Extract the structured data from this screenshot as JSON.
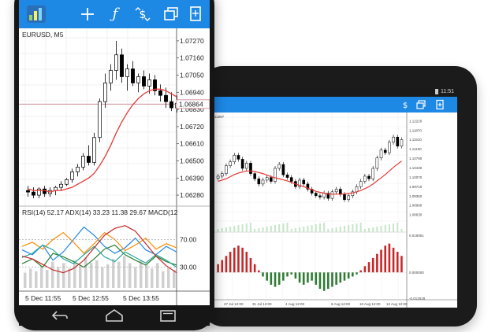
{
  "colors": {
    "toolbar_blue": "#1e88e5",
    "bull_candle": "#ffffff",
    "bear_candle": "#000000",
    "moving_average": "#e53935",
    "price_line": "#c97b8a",
    "osc_green": "#2e7d32",
    "osc_red": "#c62828"
  },
  "phone": {
    "toolbar_icons": [
      "app-logo-icon",
      "crosshair-icon",
      "function-icon",
      "trade-icon",
      "windows-icon",
      "new-document-icon"
    ],
    "chart_symbol": "EURUSD, M5",
    "price_axis": [
      "1.07270",
      "1.07160",
      "1.07050",
      "1.06940",
      "1.06864",
      "1.06830",
      "1.06720",
      "1.06610",
      "1.06500",
      "1.06390",
      "1.06280"
    ],
    "current_price": "1.06864",
    "indicator_header": "RSI(14) 52.17 ADX(14) 33.23 11.38 29.67 MACD(12",
    "indicator_axis": [
      "70.00",
      "30.00"
    ],
    "time_axis": [
      "5 Dec 11:55",
      "5 Dec 12:55",
      "5 Dec 13:55"
    ],
    "nav_icons": [
      "back-icon",
      "home-icon",
      "recent-apps-icon"
    ]
  },
  "tablet": {
    "status_time": "11:51",
    "chart_symbol": "11997",
    "price_axis": [
      "1.12220",
      "1.11870",
      "1.11510",
      "1.11150",
      "1.10790",
      "1.10430",
      "1.10070",
      "1.09710",
      "1.09350",
      "1.08990",
      "1.08630"
    ],
    "indicator_axis": [
      "0.018051",
      "0.000000",
      "-0.012528"
    ],
    "time_axis": [
      "27 Jul 12:00",
      "31 Jul 12:00",
      "4 Aug 12:00",
      "6 Aug 12:00",
      "10 Aug 12:00",
      "12 Aug 12:00"
    ],
    "side_icons": [
      "search-icon",
      "down-arrow-icon"
    ]
  },
  "chart_data": [
    {
      "type": "candlestick",
      "symbol": "EURUSD, M5",
      "ylim": [
        1.0623,
        1.0733
      ],
      "current_price": 1.06864,
      "x": [
        "5 Dec 11:55",
        "5 Dec 12:55",
        "5 Dec 13:55"
      ],
      "ohlc": [
        [
          1.0631,
          1.0634,
          1.0627,
          1.063
        ],
        [
          1.063,
          1.0633,
          1.0626,
          1.0628
        ],
        [
          1.0628,
          1.0633,
          1.0626,
          1.0632
        ],
        [
          1.0632,
          1.0634,
          1.0627,
          1.0629
        ],
        [
          1.0629,
          1.0633,
          1.0627,
          1.0631
        ],
        [
          1.0631,
          1.0634,
          1.0628,
          1.0633
        ],
        [
          1.0633,
          1.0637,
          1.0631,
          1.0635
        ],
        [
          1.0635,
          1.0639,
          1.0634,
          1.0638
        ],
        [
          1.0638,
          1.0645,
          1.0636,
          1.0643
        ],
        [
          1.0643,
          1.0648,
          1.064,
          1.0646
        ],
        [
          1.0646,
          1.0655,
          1.0644,
          1.0653
        ],
        [
          1.0653,
          1.066,
          1.0647,
          1.0649
        ],
        [
          1.0649,
          1.0668,
          1.0647,
          1.0665
        ],
        [
          1.0665,
          1.069,
          1.0662,
          1.0688
        ],
        [
          1.0688,
          1.0706,
          1.0684,
          1.07
        ],
        [
          1.07,
          1.0712,
          1.0695,
          1.0708
        ],
        [
          1.0708,
          1.0727,
          1.0702,
          1.0718
        ],
        [
          1.0718,
          1.0722,
          1.07,
          1.0704
        ],
        [
          1.0704,
          1.0712,
          1.0695,
          1.0709
        ],
        [
          1.0709,
          1.0714,
          1.0698,
          1.07
        ],
        [
          1.07,
          1.0706,
          1.0694,
          1.0704
        ],
        [
          1.0704,
          1.0708,
          1.0696,
          1.0698
        ],
        [
          1.0698,
          1.0706,
          1.0693,
          1.0702
        ],
        [
          1.0702,
          1.0705,
          1.0692,
          1.0695
        ],
        [
          1.0695,
          1.0699,
          1.0688,
          1.0692
        ],
        [
          1.0692,
          1.0697,
          1.0684,
          1.0688
        ],
        [
          1.0688,
          1.0694,
          1.0682,
          1.0684
        ],
        [
          1.0684,
          1.0692,
          1.0681,
          1.0687
        ]
      ],
      "ma": [
        1.0632,
        1.0631,
        1.0631,
        1.0631,
        1.063,
        1.0631,
        1.0631,
        1.0632,
        1.0633,
        1.0635,
        1.0637,
        1.0639,
        1.0642,
        1.0647,
        1.0653,
        1.066,
        1.0668,
        1.0675,
        1.0681,
        1.0686,
        1.069,
        1.0693,
        1.0695,
        1.0696,
        1.0696,
        1.0695,
        1.0693,
        1.0691
      ]
    },
    {
      "type": "line",
      "title": "RSI(14) 52.17 ADX(14) 33.23 11.38 29.67 MACD(12",
      "ylim": [
        0,
        100
      ],
      "yticks": [
        70,
        30
      ],
      "series": [
        {
          "name": "RSI(14)",
          "values": [
            55,
            48,
            62,
            40,
            52,
            70,
            88,
            76,
            60,
            50,
            58,
            72,
            55,
            48,
            60,
            52
          ]
        },
        {
          "name": "ADX(14)",
          "values": [
            35,
            42,
            30,
            50,
            45,
            38,
            30,
            42,
            56,
            62,
            48,
            40,
            33,
            46,
            38,
            33
          ]
        },
        {
          "name": "",
          "values": [
            60,
            66,
            56,
            70,
            80,
            66,
            50,
            64,
            80,
            70,
            54,
            62,
            72,
            56,
            64,
            58
          ]
        },
        {
          "name": "",
          "values": [
            44,
            50,
            62,
            55,
            42,
            35,
            48,
            60,
            45,
            38,
            52,
            44,
            36,
            48,
            40,
            30
          ]
        },
        {
          "name": "MACD(12",
          "values": [
            46,
            42,
            34,
            26,
            22,
            28,
            40,
            58,
            76,
            86,
            90,
            82,
            64,
            46,
            32,
            22
          ]
        }
      ],
      "histogram": [
        22,
        28,
        24,
        32,
        26,
        38,
        30,
        36,
        28,
        40,
        32,
        44,
        36,
        40,
        30,
        34,
        42,
        38,
        46,
        36,
        30,
        40,
        34,
        28,
        36,
        24,
        30,
        26
      ]
    },
    {
      "type": "candlestick",
      "ylim": [
        1.0856,
        1.123
      ],
      "ohlc_close": [
        1.101,
        1.102,
        1.105,
        1.1065,
        1.109,
        1.1075,
        1.104,
        1.106,
        1.102,
        1.1,
        1.098,
        1.0995,
        1.1005,
        1.099,
        1.104,
        1.1055,
        1.1015,
        1.1005,
        1.099,
        1.097,
        1.0995,
        1.098,
        1.096,
        1.0945,
        1.0935,
        1.093,
        1.0945,
        1.0925,
        1.095,
        1.096,
        1.094,
        1.092,
        1.0935,
        1.095,
        1.097,
        1.099,
        1.101,
        1.1,
        1.104,
        1.108,
        1.111,
        1.11,
        1.114,
        1.116,
        1.1125,
        1.115
      ],
      "ma": [
        1.099,
        1.0995,
        1.1,
        1.1008,
        1.1016,
        1.1022,
        1.1026,
        1.103,
        1.103,
        1.1028,
        1.1024,
        1.102,
        1.1014,
        1.1008,
        1.1004,
        1.1,
        1.0996,
        1.0992,
        1.0986,
        1.098,
        1.0975,
        1.097,
        1.0964,
        1.0958,
        1.0952,
        1.0948,
        1.0945,
        1.0942,
        1.0941,
        1.0941,
        1.0941,
        1.0942,
        1.0944,
        1.0946,
        1.095,
        1.0955,
        1.0962,
        1.097,
        1.098,
        1.0992,
        1.1004,
        1.1016,
        1.103,
        1.1044,
        1.1056,
        1.1068
      ]
    },
    {
      "type": "bar",
      "ylim": [
        -0.012528,
        0.018051
      ],
      "values": [
        0.004,
        0.006,
        0.008,
        0.01,
        0.012,
        0.013,
        0.012,
        0.01,
        0.007,
        0.004,
        0.001,
        -0.002,
        -0.004,
        -0.006,
        -0.007,
        -0.006,
        -0.004,
        -0.002,
        -0.001,
        -0.003,
        -0.005,
        -0.006,
        -0.005,
        -0.004,
        -0.006,
        -0.008,
        -0.009,
        -0.008,
        -0.007,
        -0.006,
        -0.005,
        -0.004,
        -0.003,
        -0.002,
        -0.001,
        0.001,
        0.003,
        0.005,
        0.007,
        0.009,
        0.011,
        0.013,
        0.014,
        0.012,
        0.01,
        0.008
      ]
    }
  ]
}
